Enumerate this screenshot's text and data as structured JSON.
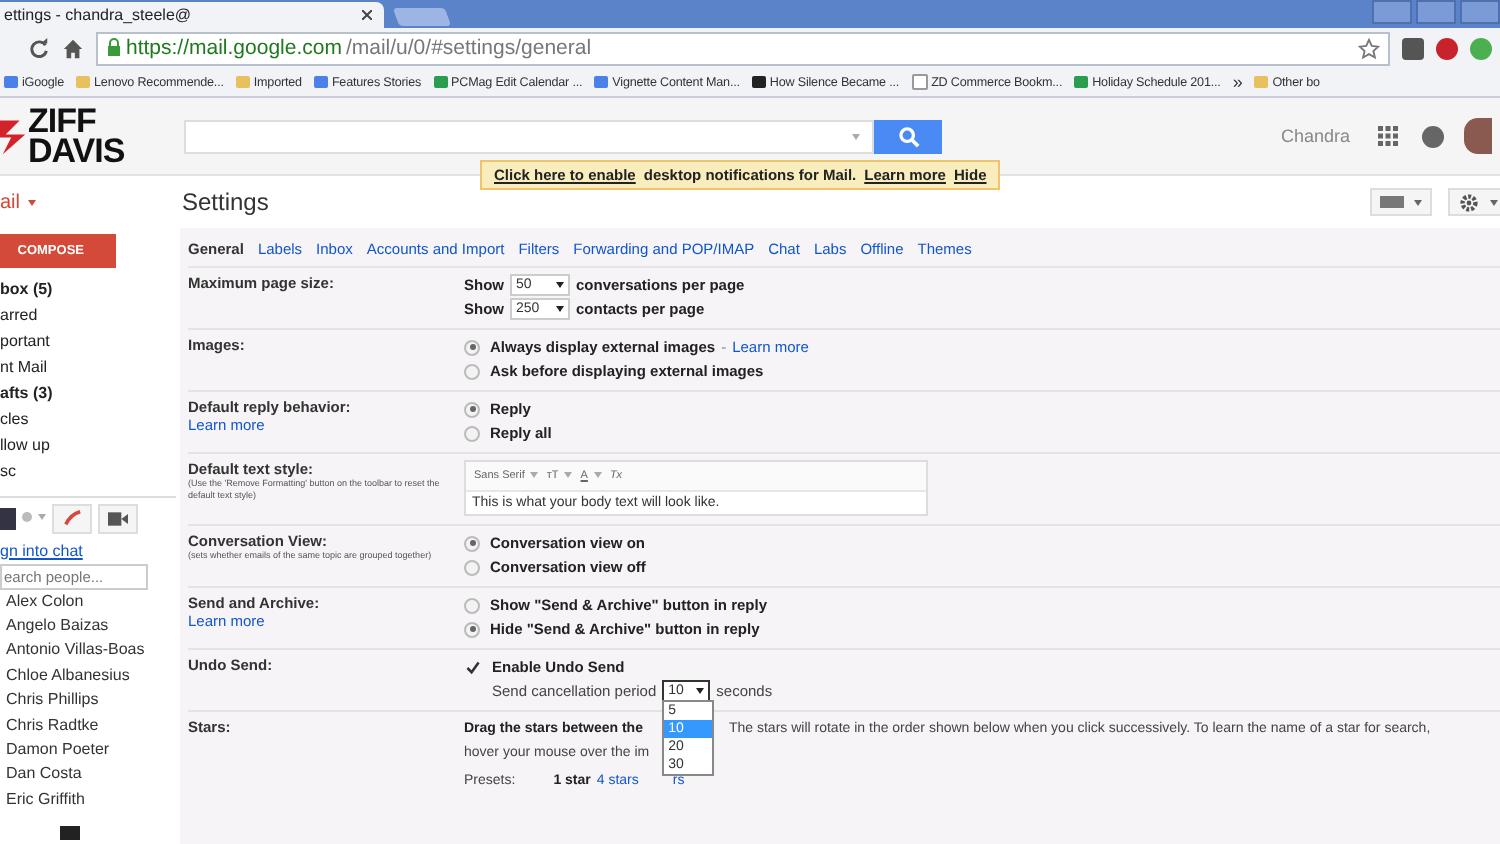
{
  "browser": {
    "tab_title": "ettings - chandra_steele@",
    "url_host": "https://mail.google.com",
    "url_path": "/mail/u/0/#settings/general",
    "bookmarks": [
      {
        "label": "iGoogle",
        "kind": "page"
      },
      {
        "label": "Lenovo Recommende...",
        "kind": "folder"
      },
      {
        "label": "Imported",
        "kind": "folder"
      },
      {
        "label": "Features Stories",
        "kind": "page"
      },
      {
        "label": "PCMag Edit Calendar ...",
        "kind": "sheet"
      },
      {
        "label": "Vignette Content Man...",
        "kind": "page"
      },
      {
        "label": "How Silence Became ...",
        "kind": "dark"
      },
      {
        "label": "ZD Commerce Bookm...",
        "kind": "doc"
      },
      {
        "label": "Holiday Schedule 201...",
        "kind": "sheet"
      }
    ],
    "more": "»",
    "other": "Other bo"
  },
  "header": {
    "logo": [
      "ZIFF",
      "DAVIS"
    ],
    "user": "Chandra"
  },
  "notification": {
    "link": "Click here to enable",
    "text": "desktop notifications for Mail.",
    "learn_more": "Learn more",
    "hide": "Hide"
  },
  "sidebar": {
    "mail_label": "ail",
    "compose": "COMPOSE",
    "nav": [
      {
        "label": "box (5)",
        "bold": true
      },
      {
        "label": "arred",
        "bold": false
      },
      {
        "label": "portant",
        "bold": false
      },
      {
        "label": "nt Mail",
        "bold": false
      },
      {
        "label": "afts (3)",
        "bold": true
      },
      {
        "label": "cles",
        "bold": false
      },
      {
        "label": "llow up",
        "bold": false
      },
      {
        "label": "sc",
        "bold": false
      }
    ],
    "chat_link": "gn into chat",
    "search_placeholder": "earch people...",
    "contacts": [
      "Alex Colon",
      "Angelo Baizas",
      "Antonio Villas-Boas",
      "Chloe Albanesius",
      "Chris Phillips",
      "Chris Radtke",
      "Damon Poeter",
      "Dan Costa",
      "Eric Griffith"
    ]
  },
  "settings": {
    "title": "Settings",
    "tabs": [
      {
        "label": "General",
        "selected": true
      },
      {
        "label": "Labels",
        "selected": false
      },
      {
        "label": "Inbox",
        "selected": false
      },
      {
        "label": "Accounts and Import",
        "selected": false
      },
      {
        "label": "Filters",
        "selected": false
      },
      {
        "label": "Forwarding and POP/IMAP",
        "selected": false
      },
      {
        "label": "Chat",
        "selected": false
      },
      {
        "label": "Labs",
        "selected": false
      },
      {
        "label": "Offline",
        "selected": false
      },
      {
        "label": "Themes",
        "selected": false
      }
    ],
    "rows": [
      {
        "kind": "selects",
        "label": "Maximum page size:",
        "lines": [
          {
            "prefix": "Show",
            "value": "50",
            "suffix": "conversations per page"
          },
          {
            "prefix": "Show",
            "value": "250",
            "suffix": "contacts per page"
          }
        ]
      },
      {
        "kind": "radios",
        "label": "Images:",
        "options": [
          {
            "label": "Always display external images",
            "selected": true,
            "separator": "-",
            "link": "Learn more"
          },
          {
            "label": "Ask before displaying external images",
            "selected": false
          }
        ]
      },
      {
        "kind": "radios",
        "label": "Default reply behavior:",
        "learn_more": "Learn more",
        "options": [
          {
            "label": "Reply",
            "selected": true
          },
          {
            "label": "Reply all",
            "selected": false
          }
        ]
      },
      {
        "kind": "editor",
        "label": "Default text style:",
        "note": "(Use the 'Remove Formatting' button on the toolbar to reset the default text style)",
        "font": "Sans Serif",
        "size_glyph": "тT",
        "color_glyph": "A",
        "clear_glyph": "Tx",
        "sample": "This is what your body text will look like."
      },
      {
        "kind": "radios",
        "label": "Conversation View:",
        "note": "(sets whether emails of the same topic are grouped together)",
        "options": [
          {
            "label": "Conversation view on",
            "selected": true
          },
          {
            "label": "Conversation view off",
            "selected": false
          }
        ]
      },
      {
        "kind": "radios",
        "label": "Send and Archive:",
        "learn_more": "Learn more",
        "options": [
          {
            "label": "Show \"Send & Archive\" button in reply",
            "selected": false
          },
          {
            "label": "Hide \"Send & Archive\" button in reply",
            "selected": true
          }
        ]
      },
      {
        "kind": "undo",
        "label": "Undo Send:",
        "checkbox": "Enable Undo Send",
        "checked": true,
        "period_label": "Send cancellation period",
        "value": "10",
        "unit": "seconds",
        "options": [
          {
            "label": "5",
            "selected": false
          },
          {
            "label": "10",
            "selected": true
          },
          {
            "label": "20",
            "selected": false
          },
          {
            "label": "30",
            "selected": false
          }
        ]
      },
      {
        "kind": "stars",
        "label": "Stars:",
        "text_a": "Drag the stars between the",
        "text_b": "The stars will rotate in the order shown below when you click successively. To learn the name of a star for search,",
        "text_c": "hover your mouse over the im",
        "presets_label": "Presets:",
        "presets": [
          {
            "label": "1 star",
            "selected": true
          },
          {
            "label": "4 stars",
            "selected": false
          },
          {
            "label": "rs",
            "selected": false
          }
        ]
      }
    ]
  }
}
